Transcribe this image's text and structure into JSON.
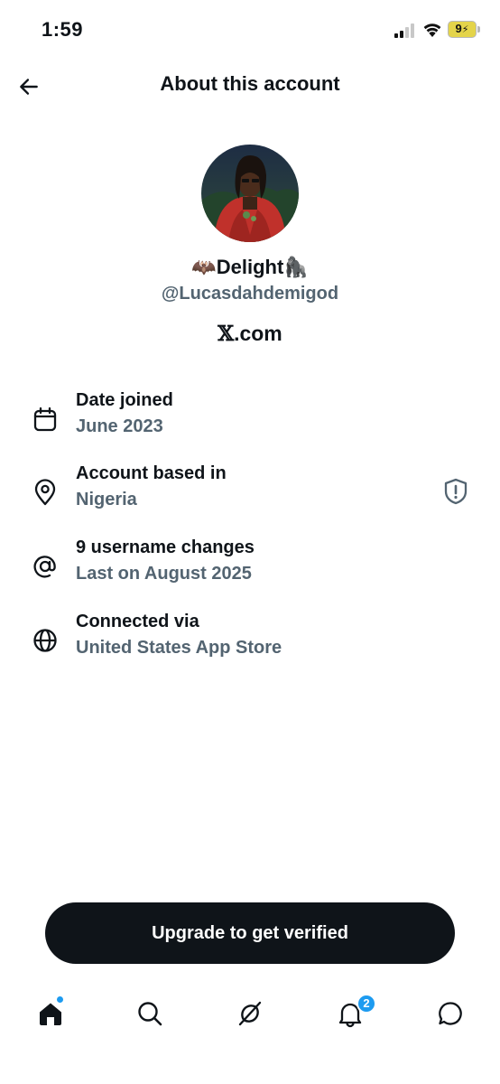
{
  "status_bar": {
    "time": "1:59",
    "battery": "9"
  },
  "header": {
    "title": "About this account",
    "back_icon": "arrow-left-icon"
  },
  "profile": {
    "avatar_icon": "profile-avatar",
    "display_name": "🦇Delight🦍",
    "handle": "@Lucasdahdemigod",
    "site_mark": "𝕏",
    "site_suffix": ".com"
  },
  "info": [
    {
      "icon": "calendar-icon",
      "title": "Date joined",
      "value": "June 2023"
    },
    {
      "icon": "location-pin-icon",
      "title": "Account based in",
      "value": "Nigeria",
      "action_icon": "shield-alert-icon"
    },
    {
      "icon": "at-sign-icon",
      "title": "9 username changes",
      "value": "Last on August 2025"
    },
    {
      "icon": "globe-icon",
      "title": "Connected via",
      "value": "United States App Store"
    }
  ],
  "cta": {
    "label": "Upgrade to get verified"
  },
  "tabbar": {
    "items": [
      {
        "icon": "home-icon",
        "name": "Home"
      },
      {
        "icon": "search-icon",
        "name": "Search"
      },
      {
        "icon": "grok-icon",
        "name": "Grok"
      },
      {
        "icon": "bell-icon",
        "name": "Notifications"
      },
      {
        "icon": "messages-icon",
        "name": "Messages"
      }
    ],
    "notification_count": "2"
  },
  "colors": {
    "text": "#0f1419",
    "secondary": "#536471",
    "accent": "#1d9bf0",
    "button_bg": "#0f1419"
  }
}
